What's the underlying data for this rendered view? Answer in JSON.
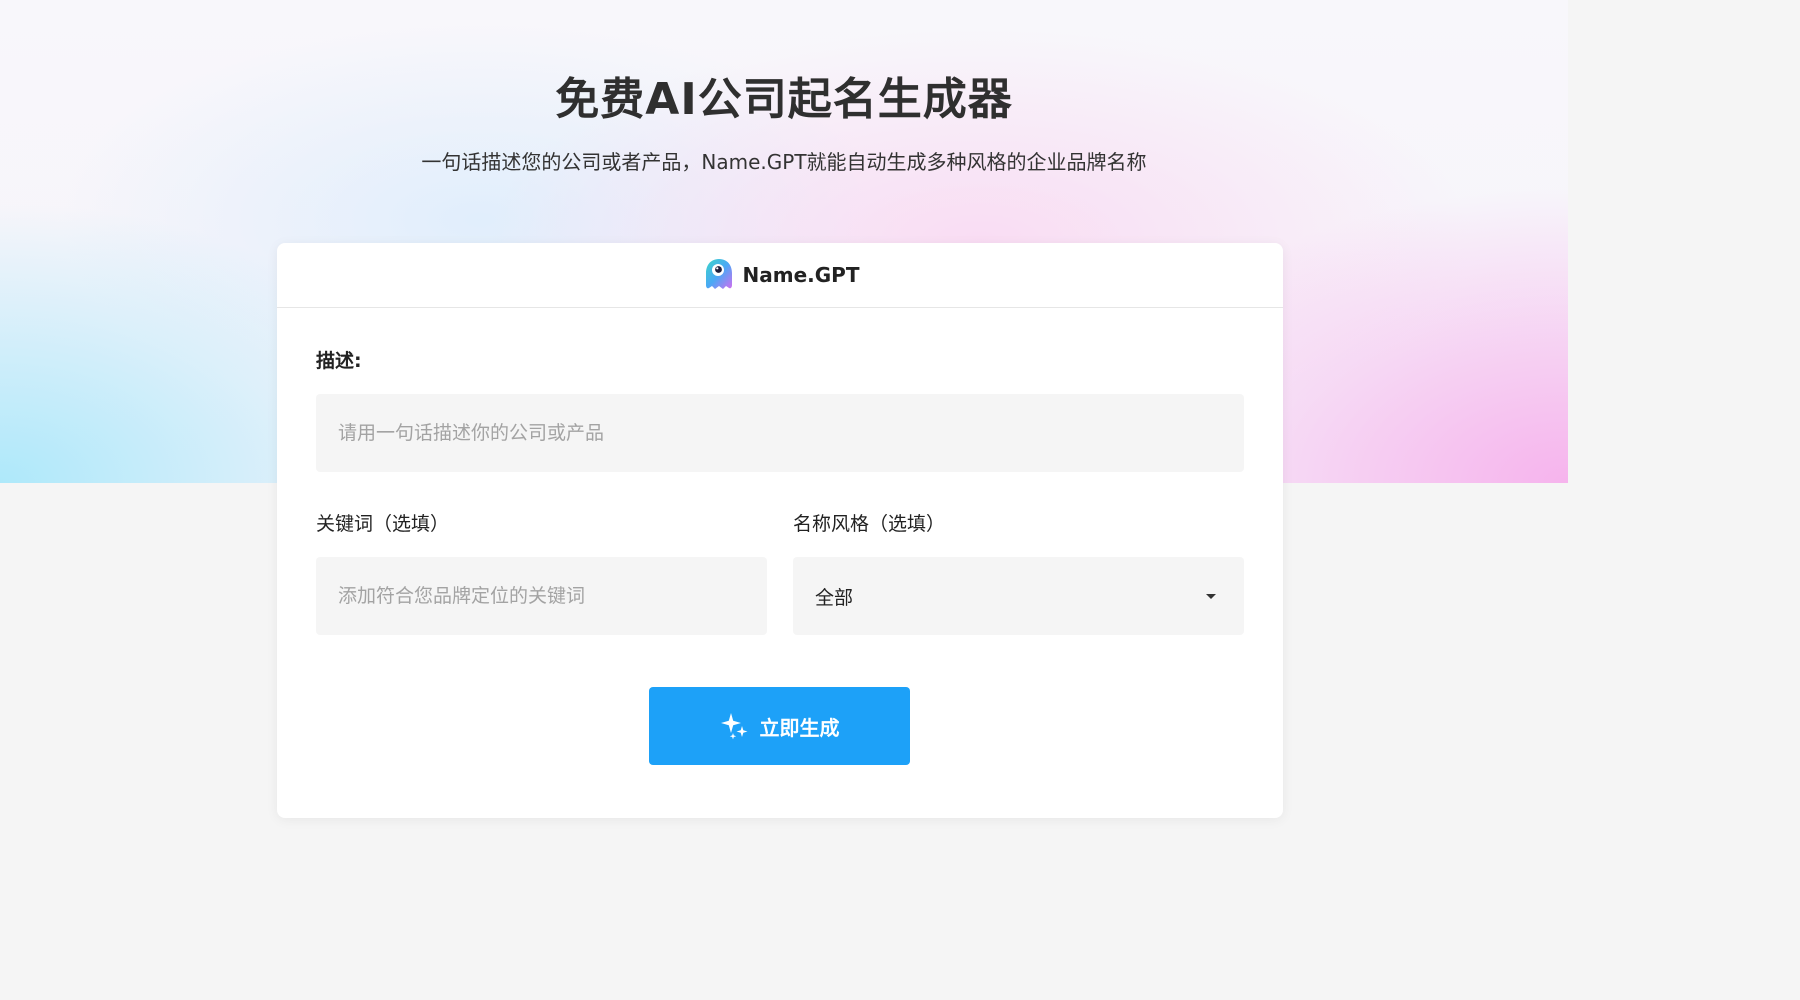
{
  "header": {
    "title": "免费AI公司起名生成器",
    "subtitle": "一句话描述您的公司或者产品，Name.GPT就能自动生成多种风格的企业品牌名称"
  },
  "card": {
    "brand_name": "Name.GPT",
    "brand_icon": "mascot-logo-icon",
    "description": {
      "label": "描述:",
      "placeholder": "请用一句话描述你的公司或产品",
      "value": ""
    },
    "keywords": {
      "label": "关键词（选填）",
      "placeholder": "添加符合您品牌定位的关键词",
      "value": ""
    },
    "style": {
      "label": "名称风格（选填）",
      "selected": "全部",
      "icon": "caret-down-icon"
    },
    "generate_button": {
      "label": "立即生成",
      "icon": "sparkle-icon"
    }
  },
  "colors": {
    "accent": "#1da1f8",
    "input_bg": "#f5f5f5",
    "page_bg": "#f5f5f5",
    "card_bg": "#ffffff"
  }
}
